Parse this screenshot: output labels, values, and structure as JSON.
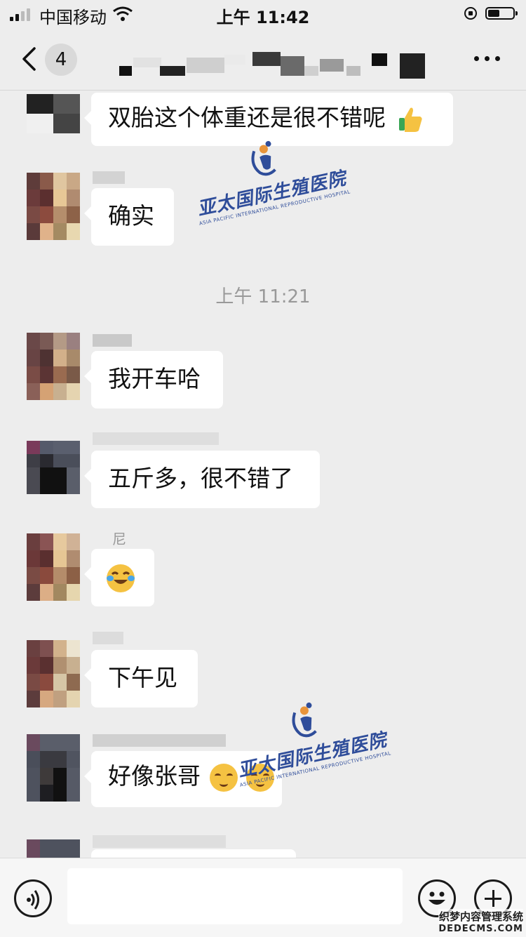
{
  "status_bar": {
    "carrier": "中国移动",
    "time": "上午 11:42"
  },
  "header": {
    "unread_count": "4"
  },
  "messages": [
    {
      "text": "双胎这个体重还是很不错呢"
    },
    {
      "sender": "",
      "text": "确实"
    },
    {
      "text": "我开车哈"
    },
    {
      "text": "五斤多，很不错了"
    },
    {
      "sender": "尼"
    },
    {
      "text": "下午见"
    },
    {
      "text": "好像张哥"
    }
  ],
  "time_separator": "上午 11:21",
  "watermark": {
    "name": "亚太国际生殖医院",
    "subtitle": "ASIA PACIFIC INTERNATIONAL REPRODUCTIVE HOSPITAL"
  },
  "input": {
    "placeholder": ""
  },
  "site_mark": {
    "line1": "织梦内容管理系统",
    "line2": "DEDECMS.COM"
  },
  "colors": {
    "background": "#ededed",
    "bubble": "#ffffff",
    "watermark": "#2f4d9a",
    "timestamp": "#999999"
  },
  "icons": [
    "back-icon",
    "more-icon",
    "thumbs-up-emoji",
    "laughing-tears-emoji",
    "blush-emoji",
    "voice-icon",
    "emoji-icon",
    "plus-icon"
  ]
}
